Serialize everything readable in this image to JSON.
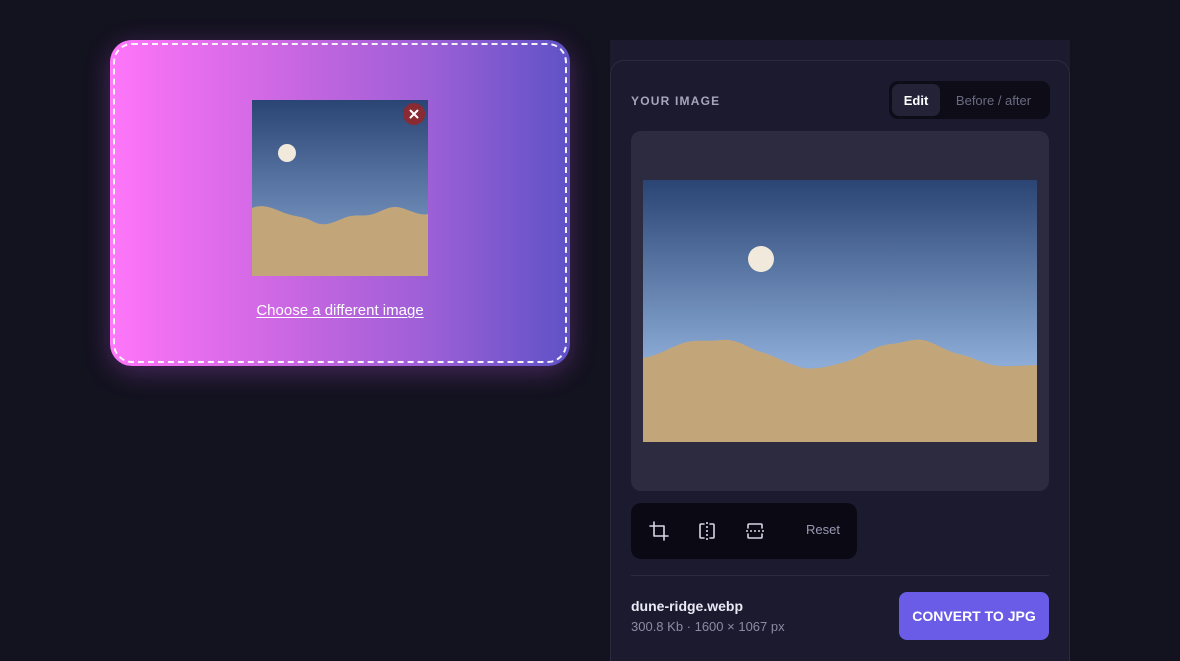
{
  "uploader": {
    "choose_label": "Choose a different image",
    "remove_icon": "close-icon"
  },
  "panel": {
    "title": "YOUR IMAGE",
    "tabs": [
      {
        "label": "Edit",
        "active": true
      },
      {
        "label": "Before / after",
        "active": false
      }
    ]
  },
  "toolbar": {
    "tools": [
      {
        "name": "crop",
        "icon": "crop-icon"
      },
      {
        "name": "flip-horizontal",
        "icon": "flip-horizontal-icon"
      },
      {
        "name": "flip-vertical",
        "icon": "flip-vertical-icon"
      }
    ],
    "reset_label": "Reset"
  },
  "file": {
    "name": "dune-ridge.webp",
    "meta": "300.8 Kb · 1600 × 1067 px"
  },
  "actions": {
    "convert_label": "CONVERT TO JPG"
  },
  "colors": {
    "background": "#13121f",
    "panel": "#1c1a2e",
    "accent": "#6a5ce6",
    "dropzone_start": "#ff78fb",
    "dropzone_end": "#5f52c7",
    "remove_button": "#8a2a33",
    "sky_top": "#2a4474",
    "sky_bottom": "#8cabd6",
    "sand": "#c2a67a",
    "sun": "#f0e9dc"
  }
}
